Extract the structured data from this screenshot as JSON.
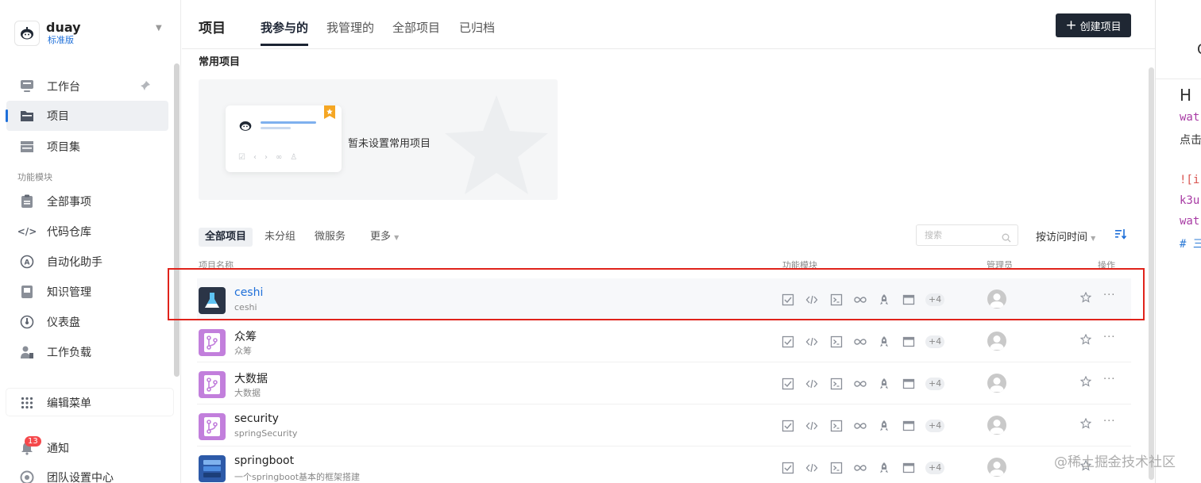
{
  "workspace": {
    "name": "duay",
    "edition": "标准版"
  },
  "sidebar": {
    "items": [
      {
        "label": "工作台",
        "icon": "workbench-icon"
      },
      {
        "label": "项目",
        "icon": "folder-icon"
      },
      {
        "label": "项目集",
        "icon": "project-set-icon"
      }
    ],
    "group_label": "功能模块",
    "modules": [
      {
        "label": "全部事项",
        "icon": "clipboard-icon"
      },
      {
        "label": "代码仓库",
        "icon": "code-icon"
      },
      {
        "label": "自动化助手",
        "icon": "automation-icon"
      },
      {
        "label": "知识管理",
        "icon": "knowledge-icon"
      },
      {
        "label": "仪表盘",
        "icon": "dashboard-icon"
      },
      {
        "label": "工作负载",
        "icon": "workload-icon"
      }
    ],
    "edit_menu": "编辑菜单",
    "notifications": {
      "label": "通知",
      "count": "13"
    },
    "team_settings": "团队设置中心"
  },
  "header": {
    "title": "项目",
    "tabs": [
      "我参与的",
      "我管理的",
      "全部项目",
      "已归档"
    ],
    "active_tab": 0,
    "create_button": "创建项目"
  },
  "favorites": {
    "title": "常用项目",
    "empty_text": "暂未设置常用项目"
  },
  "filters": {
    "tabs": [
      "全部项目",
      "未分组",
      "微服务",
      "更多"
    ],
    "search_placeholder": "搜索",
    "sort_label": "按访问时间"
  },
  "table": {
    "columns": {
      "name": "项目名称",
      "modules": "功能模块",
      "admin": "管理员",
      "actions": "操作"
    },
    "more_modules": "+4",
    "rows": [
      {
        "name": "ceshi",
        "desc": "ceshi",
        "icon": "flask-icon",
        "highlighted": true
      },
      {
        "name": "众筹",
        "desc": "众筹",
        "icon": "branch-icon",
        "highlighted": false
      },
      {
        "name": "大数据",
        "desc": "大数据",
        "icon": "branch-icon",
        "highlighted": false
      },
      {
        "name": "security",
        "desc": "springSecurity",
        "icon": "branch-icon",
        "highlighted": false
      },
      {
        "name": "springboot",
        "desc": "一个springboot基本的框架搭建",
        "icon": "stack-icon",
        "highlighted": false
      }
    ]
  },
  "colors": {
    "accent": "#1e6fd9",
    "dark_button": "#1f2733",
    "highlight_border": "#e0231b",
    "badge": "#f5484b",
    "git_purple": "#c27fdc"
  },
  "editor": {
    "top_char": "C",
    "heading": "H",
    "lines": [
      {
        "text": "wat",
        "color": "#a83aa4"
      },
      {
        "text": "点击",
        "color": "#333333"
      },
      {
        "text": "",
        "color": "#333333"
      },
      {
        "text": "![i",
        "color": "#d9534f"
      },
      {
        "text": "k3u",
        "color": "#a83aa4"
      },
      {
        "text": "wat",
        "color": "#a83aa4"
      },
      {
        "text": "# 三",
        "color": "#2e7bd6"
      }
    ]
  },
  "watermark": "@稀土掘金技术社区"
}
